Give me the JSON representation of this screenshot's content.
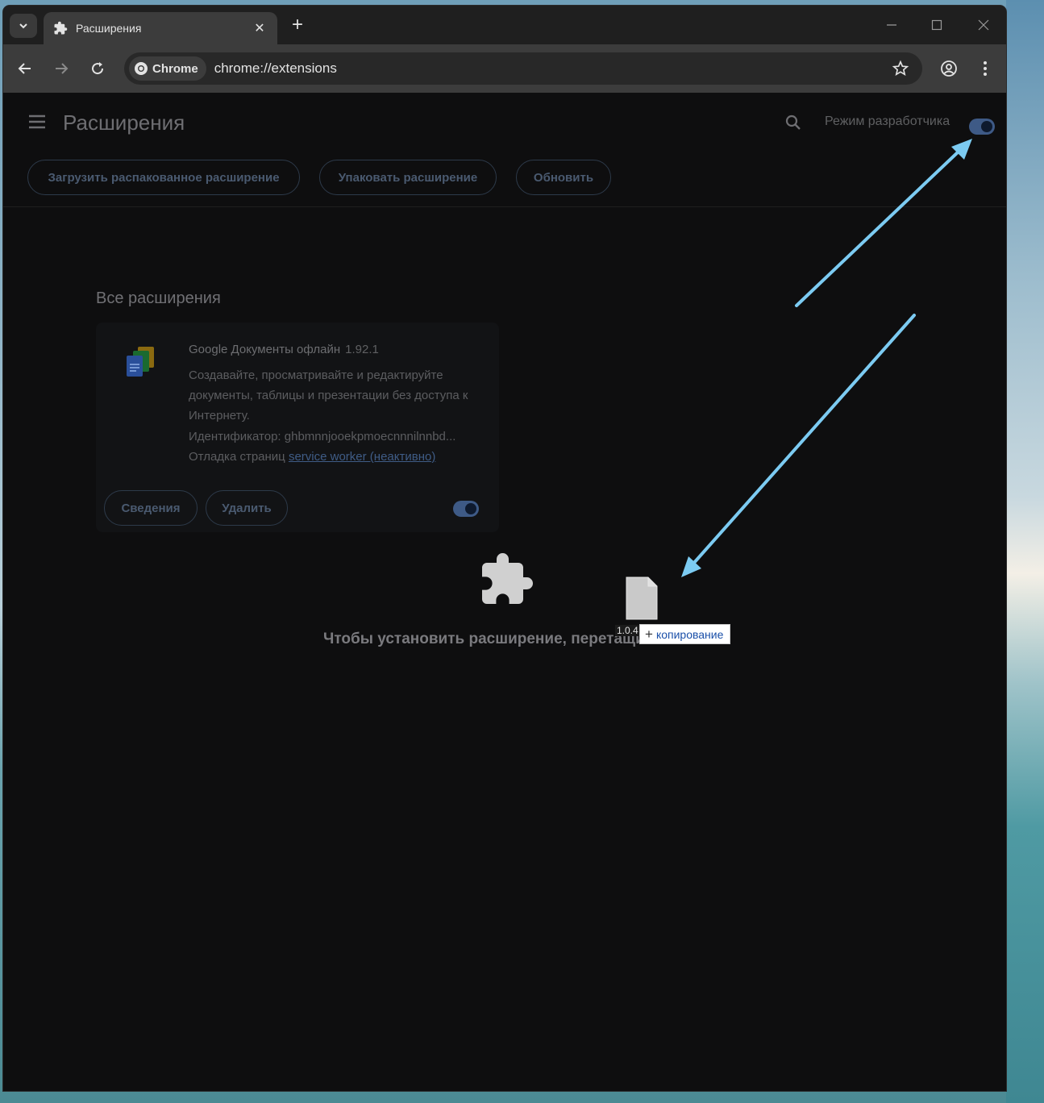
{
  "browser": {
    "tab": {
      "title": "Расширения"
    },
    "omnibox": {
      "chip_label": "Chrome",
      "url": "chrome://extensions"
    }
  },
  "page": {
    "title": "Расширения",
    "dev_mode_label": "Режим разработчика",
    "dev_mode_on": true,
    "actions": {
      "load_unpacked": "Загрузить распакованное расширение",
      "pack": "Упаковать расширение",
      "update": "Обновить"
    },
    "section_title": "Все расширения",
    "extension": {
      "name": "Google Документы офлайн",
      "version": "1.92.1",
      "description": "Создавайте, просматривайте и редактируйте документы, таблицы и презентации без доступа к Интернету.",
      "id_line": "Идентификатор: ghbmnnjooekpmoecnnnilnnbd...",
      "debug_label": "Отладка страниц",
      "debug_link": "service worker (неактивно)",
      "details_button": "Сведения",
      "remove_button": "Удалить",
      "enabled": true
    },
    "drop_message": "Чтобы установить расширение, перетащите его"
  },
  "drag": {
    "file_label": "1.0.4",
    "copy_tooltip": "копирование"
  },
  "colors": {
    "accent": "#3e5a86",
    "annotation_arrow": "#7ccbf2"
  }
}
